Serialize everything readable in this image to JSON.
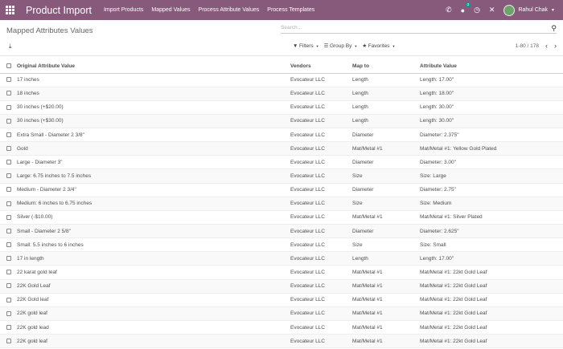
{
  "topbar": {
    "title": "Product Import",
    "menu": [
      "Import Products",
      "Mapped Values",
      "Process Attribute Values",
      "Process Templates"
    ],
    "message_count": "3",
    "user_name": "Rahul Chak"
  },
  "control_panel": {
    "breadcrumb": "Mapped Attributes Values",
    "search_placeholder": "Search...",
    "filters_label": "Filters",
    "groupby_label": "Group By",
    "favorites_label": "Favorites",
    "pager": "1-80 / 178"
  },
  "table": {
    "headers": [
      "Original Attribute Value",
      "Vendors",
      "Map to",
      "Attribute Value"
    ],
    "rows": [
      [
        "17 inches",
        "Evocateur LLC",
        "Length",
        "Length: 17.00\""
      ],
      [
        "18 inches",
        "Evocateur LLC",
        "Length",
        "Length: 18.00\""
      ],
      [
        "30 inches (+$20.00)",
        "Evocateur LLC",
        "Length",
        "Length: 30.00\""
      ],
      [
        "30 inches (+$30.00)",
        "Evocateur LLC",
        "Length",
        "Length: 30.00\""
      ],
      [
        "Extra Small - Diameter 2 3/8\"",
        "Evocateur LLC",
        "Diameter",
        "Diameter: 2.375\""
      ],
      [
        "Gold",
        "Evocateur LLC",
        "Mat/Metal #1",
        "Mat/Metal #1: Yellow Gold Plated"
      ],
      [
        "Large - Diameter 3\"",
        "Evocateur LLC",
        "Diameter",
        "Diameter: 3.00\""
      ],
      [
        "Large: 6.75 inches to 7.5 inches",
        "Evocateur LLC",
        "Size",
        "Size: Large"
      ],
      [
        "Medium - Diameter 2 3/4\"",
        "Evocateur LLC",
        "Diameter",
        "Diameter: 2.75\""
      ],
      [
        "Medium: 6 inches to 6.75 inches",
        "Evocateur LLC",
        "Size",
        "Size: Medium"
      ],
      [
        "Silver (-$10.00)",
        "Evocateur LLC",
        "Mat/Metal #1",
        "Mat/Metal #1: Silver Plated"
      ],
      [
        "Small - Diameter 2 5/8\"",
        "Evocateur LLC",
        "Diameter",
        "Diameter: 2.625\""
      ],
      [
        "Small: 5.5 inches to 6 inches",
        "Evocateur LLC",
        "Size",
        "Size: Small"
      ],
      [
        "17 in length",
        "Evocateur LLC",
        "Length",
        "Length: 17.00\""
      ],
      [
        "22 karat gold leaf",
        "Evocateur LLC",
        "Mat/Metal #1",
        "Mat/Metal #1: 22kt Gold Leaf"
      ],
      [
        "22K Gold Leaf",
        "Evocateur LLC",
        "Mat/Metal #1",
        "Mat/Metal #1: 22kt Gold Leaf"
      ],
      [
        "22K Gold leaf",
        "Evocateur LLC",
        "Mat/Metal #1",
        "Mat/Metal #1: 22kt Gold Leaf"
      ],
      [
        "22K gold leaf",
        "Evocateur LLC",
        "Mat/Metal #1",
        "Mat/Metal #1: 22kt Gold Leaf"
      ],
      [
        "22K gold lead",
        "Evocateur LLC",
        "Mat/Metal #1",
        "Mat/Metal #1: 22kt Gold Leaf"
      ],
      [
        "22K gold leaf",
        "Evocateur LLC",
        "Mat/Metal #1",
        "Mat/Metal #1: 22kt Gold Leaf"
      ]
    ]
  },
  "colors": {
    "brand": "#875a7b",
    "badge": "#00a09d"
  }
}
